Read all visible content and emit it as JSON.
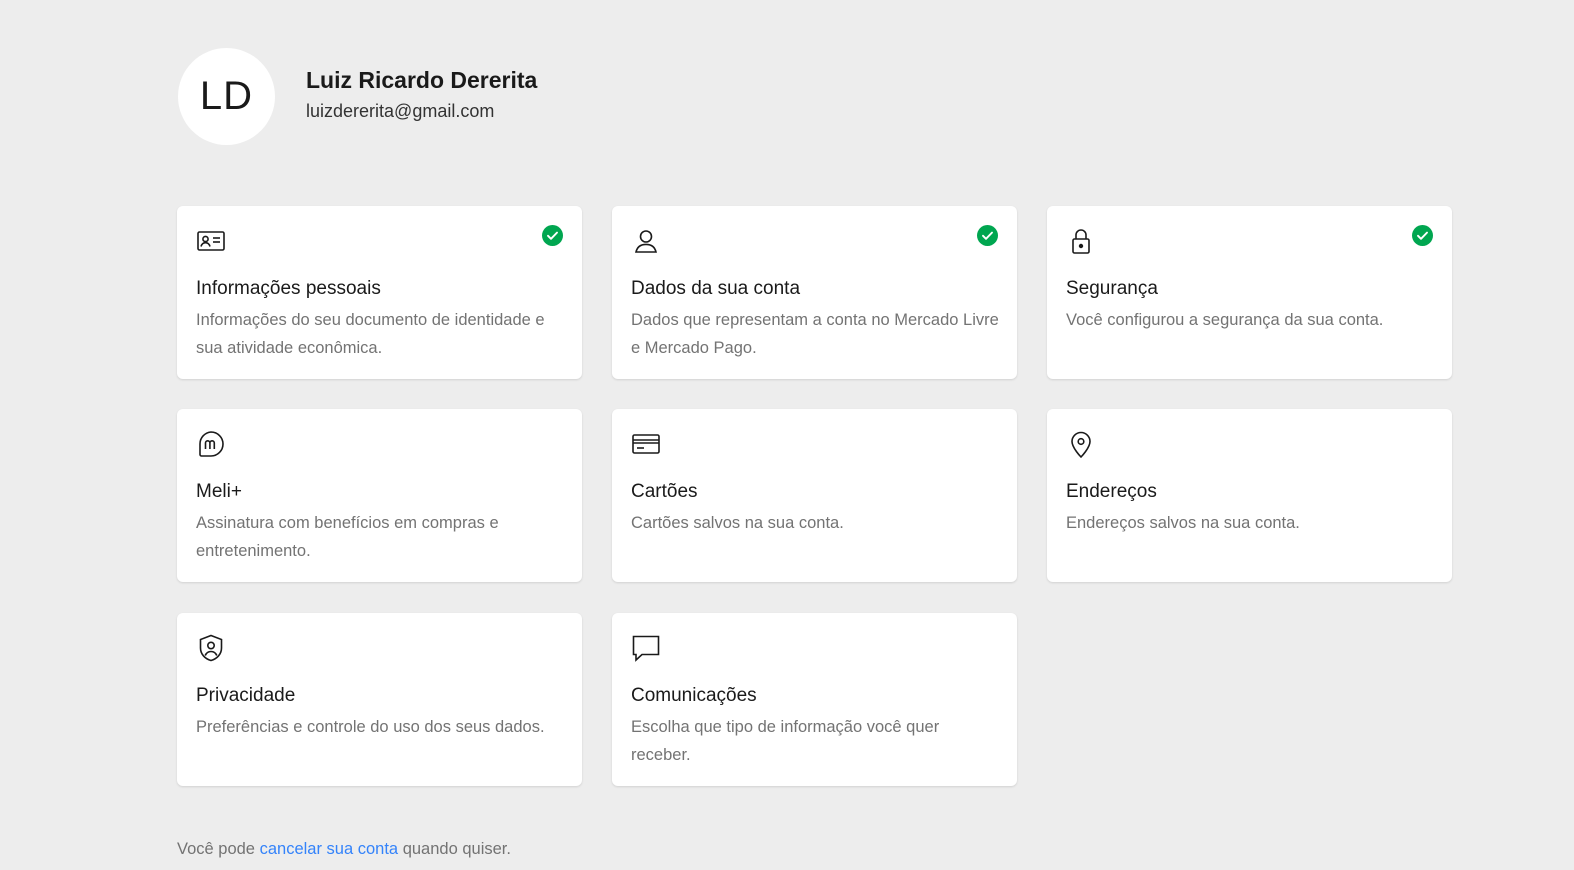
{
  "profile": {
    "initials": "LD",
    "name": "Luiz Ricardo Dererita",
    "email": "luizdererita@gmail.com"
  },
  "colors": {
    "accent": "#3483fa",
    "check": "#00a650",
    "background": "#ededed"
  },
  "cards": [
    {
      "icon": "id-card-icon",
      "title": "Informações pessoais",
      "desc": "Informações do seu documento de identidade e sua atividade econômica.",
      "verified": true
    },
    {
      "icon": "user-icon",
      "title": "Dados da sua conta",
      "desc": "Dados que representam a conta no Mercado Livre e Mercado Pago.",
      "verified": true
    },
    {
      "icon": "lock-icon",
      "title": "Segurança",
      "desc": "Você configurou a segurança da sua conta.",
      "verified": true
    },
    {
      "icon": "meli-plus-icon",
      "title": "Meli+",
      "desc": "Assinatura com benefícios em compras e entretenimento.",
      "verified": false
    },
    {
      "icon": "credit-card-icon",
      "title": "Cartões",
      "desc": "Cartões salvos na sua conta.",
      "verified": false
    },
    {
      "icon": "location-pin-icon",
      "title": "Endereços",
      "desc": "Endereços salvos na sua conta.",
      "verified": false
    },
    {
      "icon": "privacy-shield-icon",
      "title": "Privacidade",
      "desc": "Preferências e controle do uso dos seus dados.",
      "verified": false
    },
    {
      "icon": "chat-bubble-icon",
      "title": "Comunicações",
      "desc": "Escolha que tipo de informação você quer receber.",
      "verified": false
    }
  ],
  "footer": {
    "prefix": "Você pode",
    "link": "cancelar sua conta",
    "suffix": "quando quiser."
  }
}
